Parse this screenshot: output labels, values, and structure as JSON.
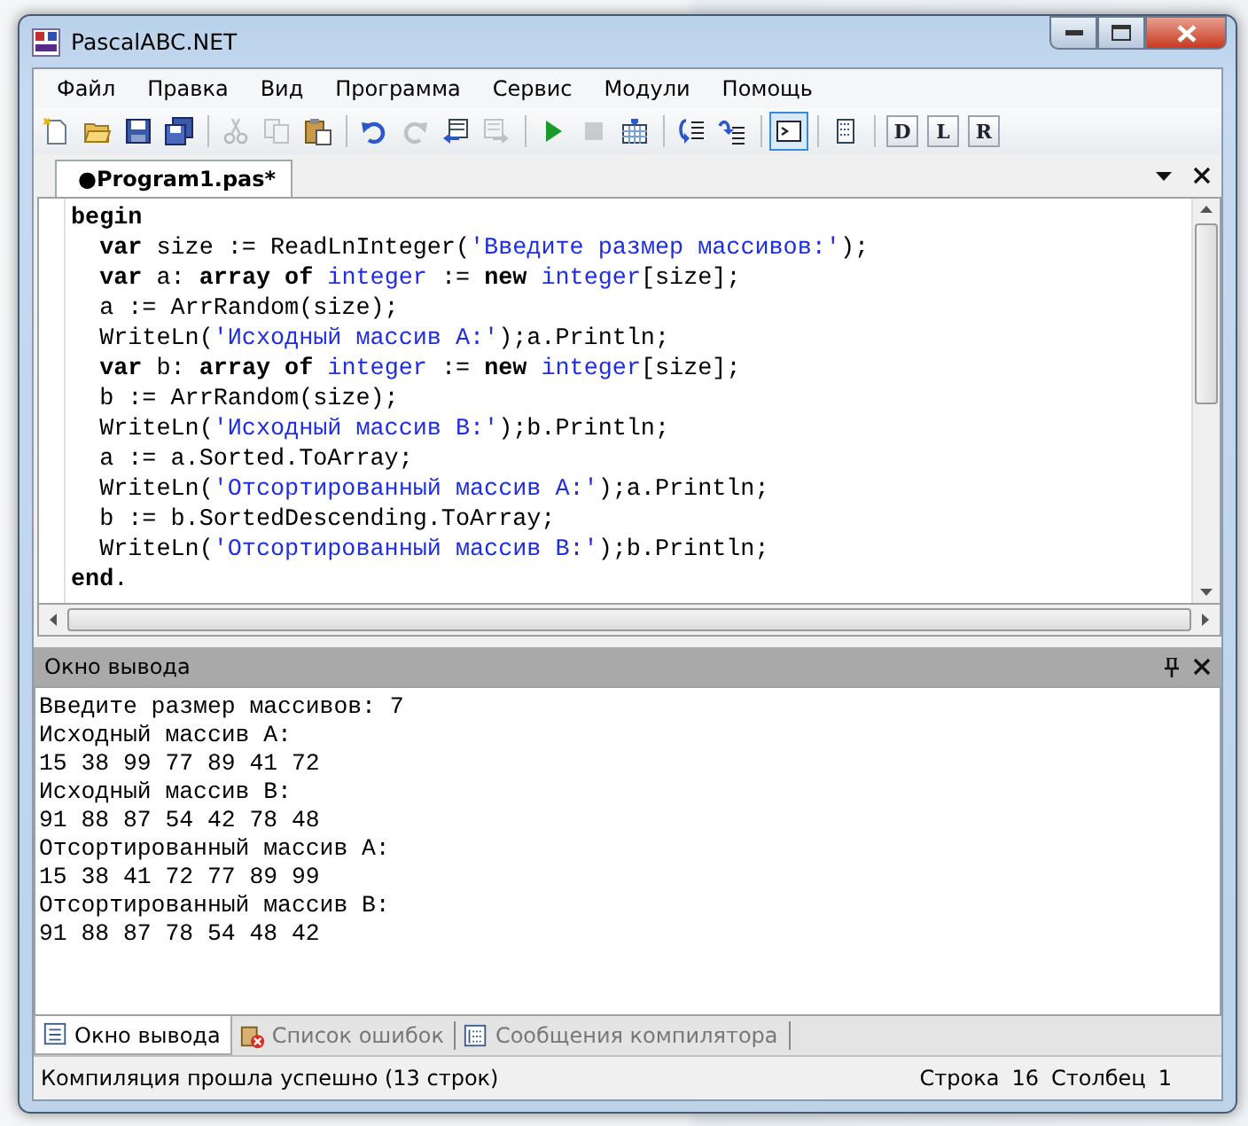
{
  "window": {
    "title": "PascalABC.NET"
  },
  "menu": [
    "Файл",
    "Правка",
    "Вид",
    "Программа",
    "Сервис",
    "Модули",
    "Помощь"
  ],
  "toolbar": [
    {
      "kind": "new",
      "disabled": false,
      "selected": false
    },
    {
      "kind": "open",
      "disabled": false,
      "selected": false
    },
    {
      "kind": "save",
      "disabled": false,
      "selected": false
    },
    {
      "kind": "save_all",
      "disabled": false,
      "selected": false
    },
    {
      "kind": "separator"
    },
    {
      "kind": "cut",
      "disabled": true,
      "selected": false
    },
    {
      "kind": "copy",
      "disabled": true,
      "selected": false
    },
    {
      "kind": "paste",
      "disabled": false,
      "selected": false
    },
    {
      "kind": "separator"
    },
    {
      "kind": "undo",
      "disabled": false,
      "selected": false
    },
    {
      "kind": "redo",
      "disabled": true,
      "selected": false
    },
    {
      "kind": "back",
      "disabled": false,
      "selected": false
    },
    {
      "kind": "forward",
      "disabled": true,
      "selected": false
    },
    {
      "kind": "separator"
    },
    {
      "kind": "run",
      "disabled": false,
      "selected": false
    },
    {
      "kind": "stop",
      "disabled": true,
      "selected": false
    },
    {
      "kind": "compile",
      "disabled": false,
      "selected": false
    },
    {
      "kind": "separator"
    },
    {
      "kind": "step_into",
      "disabled": false,
      "selected": false
    },
    {
      "kind": "step_over",
      "disabled": false,
      "selected": false
    },
    {
      "kind": "separator"
    },
    {
      "kind": "console",
      "disabled": false,
      "selected": true
    },
    {
      "kind": "separator"
    },
    {
      "kind": "document",
      "disabled": false,
      "selected": false
    },
    {
      "kind": "separator"
    },
    {
      "kind": "letter",
      "letter": "D",
      "disabled": false
    },
    {
      "kind": "letter",
      "letter": "L",
      "disabled": false
    },
    {
      "kind": "letter",
      "letter": "R",
      "disabled": false
    }
  ],
  "editor": {
    "tabs": [
      {
        "label": "●Program1.pas*",
        "selected": true
      }
    ],
    "lines": [
      [
        {
          "text": "begin",
          "kind": "keyword"
        }
      ],
      [
        {
          "text": "  var",
          "kind": "keyword"
        },
        {
          "text": " size := ReadLnInteger(",
          "kind": "plain"
        },
        {
          "text": "'Введите размер массивов:'",
          "kind": "string"
        },
        {
          "text": ");",
          "kind": "plain"
        }
      ],
      [
        {
          "text": "  var",
          "kind": "keyword"
        },
        {
          "text": " a: ",
          "kind": "plain"
        },
        {
          "text": "array of ",
          "kind": "keyword"
        },
        {
          "text": "integer",
          "kind": "type"
        },
        {
          "text": " := ",
          "kind": "plain"
        },
        {
          "text": "new ",
          "kind": "keyword"
        },
        {
          "text": "integer",
          "kind": "type"
        },
        {
          "text": "[size];",
          "kind": "plain"
        }
      ],
      [
        {
          "text": "  a := ArrRandom(size);",
          "kind": "plain"
        }
      ],
      [
        {
          "text": "  WriteLn(",
          "kind": "plain"
        },
        {
          "text": "'Исходный массив A:'",
          "kind": "string"
        },
        {
          "text": ");a.Println;",
          "kind": "plain"
        }
      ],
      [
        {
          "text": "  var",
          "kind": "keyword"
        },
        {
          "text": " b: ",
          "kind": "plain"
        },
        {
          "text": "array of ",
          "kind": "keyword"
        },
        {
          "text": "integer",
          "kind": "type"
        },
        {
          "text": " := ",
          "kind": "plain"
        },
        {
          "text": "new ",
          "kind": "keyword"
        },
        {
          "text": "integer",
          "kind": "type"
        },
        {
          "text": "[size];",
          "kind": "plain"
        }
      ],
      [
        {
          "text": "  b := ArrRandom(size);",
          "kind": "plain"
        }
      ],
      [
        {
          "text": "  WriteLn(",
          "kind": "plain"
        },
        {
          "text": "'Исходный массив B:'",
          "kind": "string"
        },
        {
          "text": ");b.Println;",
          "kind": "plain"
        }
      ],
      [
        {
          "text": "  a := a.Sorted.ToArray;",
          "kind": "plain"
        }
      ],
      [
        {
          "text": "  WriteLn(",
          "kind": "plain"
        },
        {
          "text": "'Отсортированный массив A:'",
          "kind": "string"
        },
        {
          "text": ");a.Println;",
          "kind": "plain"
        }
      ],
      [
        {
          "text": "  b := b.SortedDescending.ToArray;",
          "kind": "plain"
        }
      ],
      [
        {
          "text": "  WriteLn(",
          "kind": "plain"
        },
        {
          "text": "'Отсортированный массив B:'",
          "kind": "string"
        },
        {
          "text": ");b.Println;",
          "kind": "plain"
        }
      ],
      [
        {
          "text": "end",
          "kind": "keyword"
        },
        {
          "text": ".",
          "kind": "plain"
        }
      ]
    ]
  },
  "output": {
    "title": "Окно вывода",
    "lines": [
      "Введите размер массивов: 7",
      "Исходный массив A:",
      "15 38 99 77 89 41 72",
      "Исходный массив B:",
      "91 88 87 54 42 78 48",
      "Отсортированный массив A:",
      "15 38 41 72 77 89 99",
      "Отсортированный массив B:",
      "91 88 87 78 54 48 42"
    ]
  },
  "bottom_tabs": [
    {
      "label": "Окно вывода",
      "kind": "output",
      "selected": true
    },
    {
      "label": "Список ошибок",
      "kind": "errors",
      "selected": false
    },
    {
      "label": "Сообщения компилятора",
      "kind": "messages",
      "selected": false
    }
  ],
  "status_bar": {
    "message": "Компиляция прошла успешно (13 строк)",
    "line_label": "Строка",
    "line": "16",
    "column_label": "Столбец",
    "column": "1"
  }
}
